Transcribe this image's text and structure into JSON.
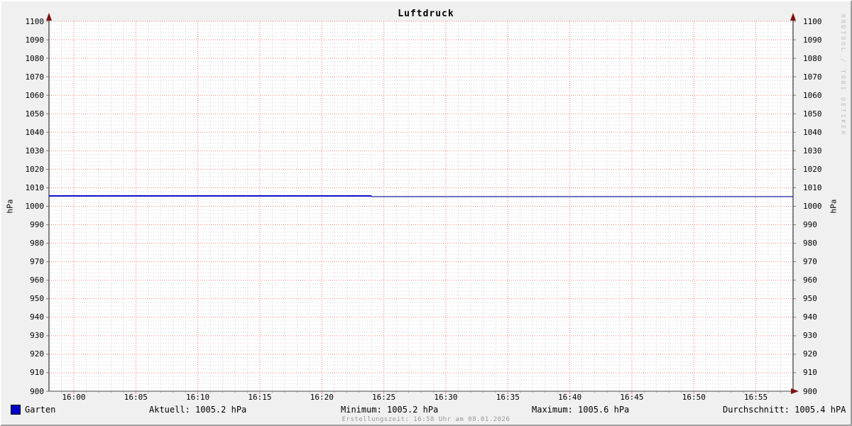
{
  "title": "Luftdruck",
  "watermark": "RRDTOOL / TOBI OETIKER",
  "y_axis": {
    "label_left": "hPa",
    "label_right": "hPa",
    "tick_labels": [
      "1100",
      "1090",
      "1080",
      "1070",
      "1060",
      "1050",
      "1040",
      "1030",
      "1020",
      "1010",
      "1000",
      "990",
      "980",
      "970",
      "960",
      "950",
      "940",
      "930",
      "920",
      "910",
      "900"
    ],
    "tick_values": [
      1100,
      1090,
      1080,
      1070,
      1060,
      1050,
      1040,
      1030,
      1020,
      1010,
      1000,
      990,
      980,
      970,
      960,
      950,
      940,
      930,
      920,
      910,
      900
    ]
  },
  "x_axis": {
    "ticks": [
      {
        "label": "16:00",
        "t_min": 2
      },
      {
        "label": "16:05",
        "t_min": 7
      },
      {
        "label": "16:10",
        "t_min": 12
      },
      {
        "label": "16:15",
        "t_min": 17
      },
      {
        "label": "16:20",
        "t_min": 22
      },
      {
        "label": "16:25",
        "t_min": 27
      },
      {
        "label": "16:30",
        "t_min": 32
      },
      {
        "label": "16:35",
        "t_min": 37
      },
      {
        "label": "16:40",
        "t_min": 42
      },
      {
        "label": "16:45",
        "t_min": 47
      },
      {
        "label": "16:50",
        "t_min": 52
      },
      {
        "label": "16:55",
        "t_min": 57
      }
    ]
  },
  "legend": {
    "series_label": "Garten",
    "swatch_color": "#0000c8",
    "stats": {
      "aktuell": "Aktuell: 1005.2 hPa",
      "minimum": "Minimum: 1005.2 hPa",
      "maximum": "Maximum: 1005.6 hPa",
      "durchschnitt": "Durchschnitt: 1005.4 hPA"
    }
  },
  "footer": "Erstellungszeit: 16:58 Uhr am 08.01.2026",
  "colors": {
    "line": "#0000c8",
    "line_dark": "#000a96",
    "grid_major": "#f28080",
    "grid_minor": "#d2d2da",
    "axis": "#5a5a5a",
    "arrow": "#801010",
    "canvas": "#ffffff",
    "background": "#f0f0f0"
  },
  "chart_data": {
    "type": "line",
    "title": "Luftdruck",
    "ylabel": "hPa",
    "ylim": [
      900,
      1100
    ],
    "y_major_step": 10,
    "y_minor_step": 2,
    "x_range_minutes": 60,
    "x_start": "15:58",
    "x_end": "16:58",
    "x_major_step_min": 5,
    "x_minor_step_min": 1,
    "grid": true,
    "legend_position": "bottom-left",
    "series": [
      {
        "name": "Garten",
        "color": "#0000c8",
        "points": [
          {
            "t_min": 0,
            "hPa": 1005.6
          },
          {
            "t_min": 26,
            "hPa": 1005.6
          },
          {
            "t_min": 26,
            "hPa": 1005.2
          },
          {
            "t_min": 60,
            "hPa": 1005.2
          }
        ]
      }
    ],
    "stats": {
      "aktuell_hPa": 1005.2,
      "minimum_hPa": 1005.2,
      "maximum_hPa": 1005.6,
      "durchschnitt_hPa": 1005.4
    }
  }
}
